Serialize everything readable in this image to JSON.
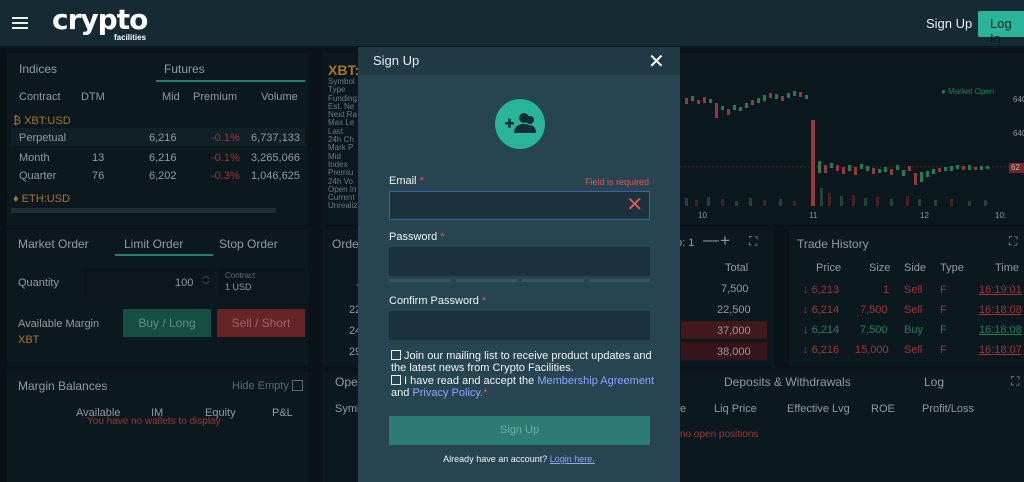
{
  "header": {
    "brand": "crypto",
    "brand_sub": "facilities",
    "signup": "Sign Up",
    "login": "Log In"
  },
  "left_top": {
    "tabs": [
      "Indices",
      "Futures"
    ],
    "columns": [
      "Contract",
      "DTM",
      "Mid",
      "Premium",
      "Volume"
    ],
    "group1": "XBT:USD",
    "rows": [
      {
        "contract": "Perpetual",
        "dtm": "",
        "mid": "6,216",
        "premium": "-0.1%",
        "volume": "6,737,133"
      },
      {
        "contract": "Month",
        "dtm": "13",
        "mid": "6,216",
        "premium": "-0.1%",
        "volume": "3,265,066"
      },
      {
        "contract": "Quarter",
        "dtm": "76",
        "mid": "6,202",
        "premium": "-0.3%",
        "volume": "1,046,625"
      }
    ],
    "group2": "ETH:USD"
  },
  "order": {
    "tabs": [
      "Market Order",
      "Limit Order",
      "Stop Order"
    ],
    "quantity_label": "Quantity",
    "quantity_value": "100",
    "contract_label": "Contract",
    "contract_value": "1 USD",
    "margin_label": "Available Margin",
    "margin_currency": "XBT",
    "buy": "Buy / Long",
    "sell": "Sell / Short"
  },
  "balances": {
    "title": "Margin Balances",
    "hide_empty": "Hide Empty",
    "columns": [
      "Available",
      "IM",
      "Equity",
      "P&L"
    ],
    "empty": "You have no wallets to display"
  },
  "chart": {
    "title": "XBT:",
    "info": [
      "Symbol",
      "Type",
      "Funding",
      "Est. Ne",
      "Next Ra",
      "Max Le",
      "Last",
      "24h Ch",
      "Mark P",
      "Mid",
      "Index",
      "Premiu",
      "24h Vo",
      "Open In",
      "Current",
      "Unrealiz"
    ],
    "market_status": "Market Open",
    "x_labels": [
      "10",
      "11",
      "12",
      "10:"
    ],
    "y_labels": [
      "640",
      "640",
      "62"
    ]
  },
  "orderbook": {
    "title": "Orde",
    "step_label": "p: 1",
    "total_header": "Total",
    "totals": [
      "7,500",
      "22,500",
      "37,000",
      "38,000"
    ],
    "prices": [
      "7",
      "22",
      "24",
      "29"
    ]
  },
  "trades": {
    "title": "Trade History",
    "columns": [
      "Price",
      "Size",
      "Side",
      "Type",
      "Time"
    ],
    "rows": [
      {
        "price": "6,213",
        "size": "1",
        "side": "Sell",
        "type": "F",
        "time": "16:19:01"
      },
      {
        "price": "6,214",
        "size": "7,500",
        "side": "Sell",
        "type": "F",
        "time": "16:18:08"
      },
      {
        "price": "6,214",
        "size": "7,500",
        "side": "Buy",
        "type": "F",
        "time": "16:18:08"
      },
      {
        "price": "6,216",
        "size": "15,000",
        "side": "Sell",
        "type": "F",
        "time": "16:18:07"
      }
    ]
  },
  "positions": {
    "tabs": [
      "Ope",
      "Deposits & Withdrawals",
      "Log"
    ],
    "columns": [
      "Symb",
      "e",
      "Liq Price",
      "Effective Lvg",
      "ROE",
      "Profit/Loss"
    ],
    "empty": "no open positions"
  },
  "modal": {
    "title": "Sign Up",
    "email_label": "Email",
    "required_mark": "*",
    "email_error": "Field is required",
    "email_value": "",
    "password_label": "Password",
    "confirm_label": "Confirm Password",
    "mailing": "Join our mailing list to receive product updates and the latest news from Crypto Facilities.",
    "terms_prefix": "I have read and accept the",
    "terms_link1": "Membership Agreement",
    "terms_and": "and",
    "terms_link2": "Privacy Policy.",
    "submit": "Sign Up",
    "already": "Already have an account?",
    "login_here": "Login here."
  },
  "colors": {
    "accent": "#2ab59a",
    "error": "#e0555b",
    "link": "#8fa6ff",
    "sell": "#d94b4b",
    "buy": "#29b07d"
  }
}
